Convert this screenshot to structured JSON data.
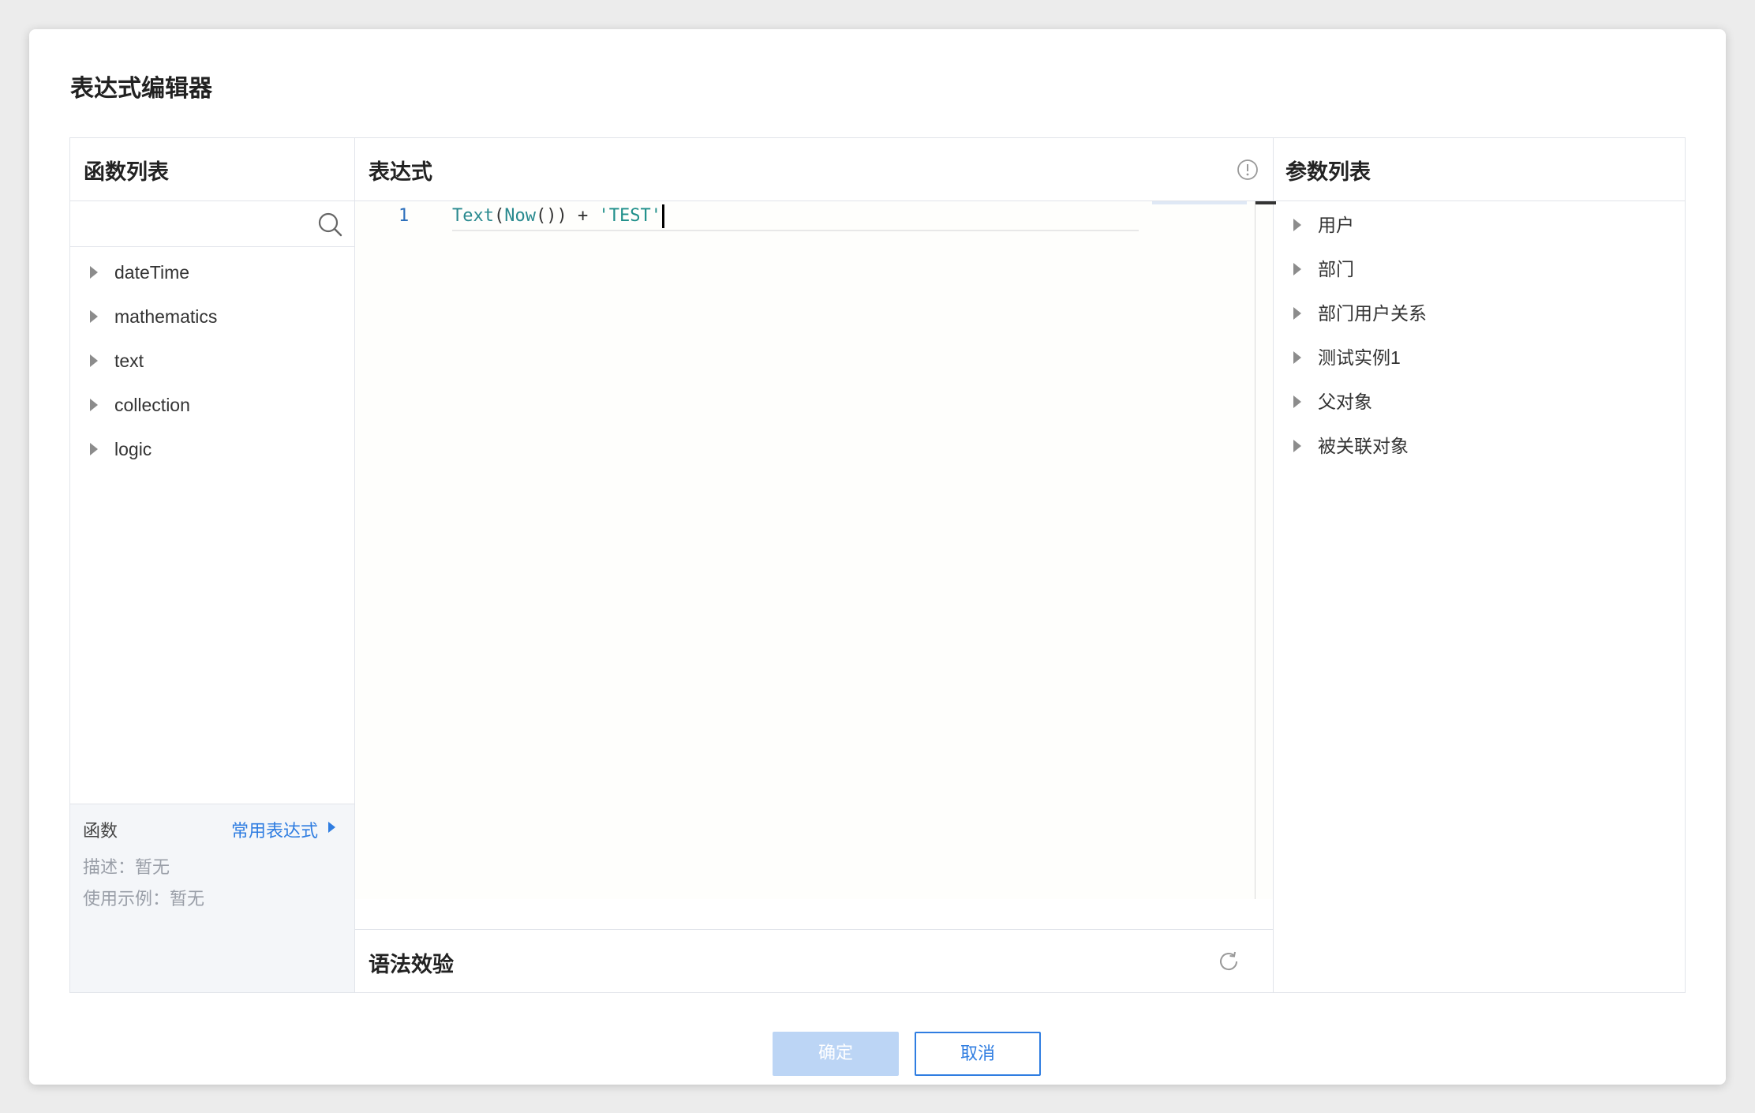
{
  "dialog": {
    "title": "表达式编辑器",
    "confirm_label": "确定",
    "cancel_label": "取消"
  },
  "function_panel": {
    "header": "函数列表",
    "search": {
      "value": "",
      "placeholder": ""
    },
    "items": [
      {
        "label": "dateTime"
      },
      {
        "label": "mathematics"
      },
      {
        "label": "text"
      },
      {
        "label": "collection"
      },
      {
        "label": "logic"
      }
    ],
    "info": {
      "title": "函数",
      "link_label": "常用表达式",
      "description": "描述：暂无",
      "example": "使用示例：暂无"
    }
  },
  "expression_panel": {
    "header": "表达式",
    "line_number": "1",
    "code_tokens": [
      {
        "text": "Text",
        "type": "fn"
      },
      {
        "text": "(",
        "type": "p"
      },
      {
        "text": "Now",
        "type": "fn"
      },
      {
        "text": "()) + ",
        "type": "p"
      },
      {
        "text": "'TEST'",
        "type": "str"
      }
    ],
    "syntax_label": "语法效验"
  },
  "param_panel": {
    "header": "参数列表",
    "items": [
      {
        "label": "用户"
      },
      {
        "label": "部门"
      },
      {
        "label": "部门用户关系"
      },
      {
        "label": "测试实例1"
      },
      {
        "label": "父对象"
      },
      {
        "label": "被关联对象"
      }
    ]
  },
  "colors": {
    "accent": "#2f7de1",
    "confirm_disabled": "#bcd5f5",
    "border": "#e1e4ea"
  }
}
